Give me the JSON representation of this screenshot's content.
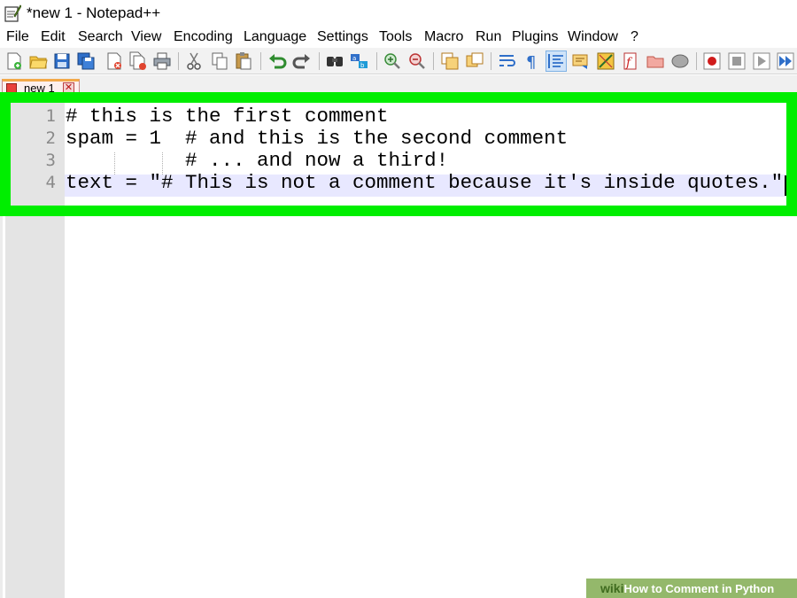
{
  "window": {
    "title": "*new 1 - Notepad++"
  },
  "menu": [
    "File",
    "Edit",
    "Search",
    "View",
    "Encoding",
    "Language",
    "Settings",
    "Tools",
    "Macro",
    "Run",
    "Plugins",
    "Window",
    "?"
  ],
  "toolbar": {
    "icons": [
      "new-file",
      "open-file",
      "save",
      "save-all",
      "close",
      "close-all",
      "print",
      "cut",
      "copy",
      "paste",
      "undo",
      "redo",
      "find",
      "replace",
      "zoom-in",
      "zoom-out",
      "sync-vertical",
      "sync-horizontal",
      "word-wrap",
      "show-all-chars",
      "indent-guide",
      "document-map",
      "function-list",
      "folder-as-workspace",
      "monitoring",
      "record-macro",
      "stop-macro",
      "playback-macro",
      "run-macro-multiple"
    ]
  },
  "tab": {
    "label": "new 1",
    "close_glyph": "✕"
  },
  "editor": {
    "line_numbers": [
      "1",
      "2",
      "3",
      "4"
    ],
    "lines": [
      "# this is the first comment",
      "spam = 1  # and this is the second comment",
      "          # ... and now a third!",
      "text = \"# This is not a comment because it's inside quotes.\""
    ]
  },
  "watermark": {
    "brand": "wiki",
    "text": "How to Comment in Python"
  },
  "colors": {
    "highlight": "#00ee00",
    "gutter": "#e4e4e4",
    "current_line": "#e8e8ff"
  }
}
